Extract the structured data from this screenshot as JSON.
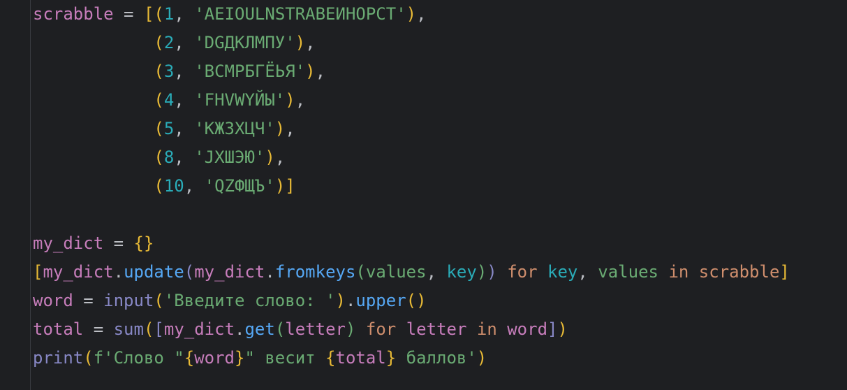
{
  "colors": {
    "background": "#1e1f22",
    "gutter_border": "#393b40",
    "variable": "#c77dbb",
    "default": "#bcbec4",
    "number": "#2aacb8",
    "string": "#6aab73",
    "paren_outer": "#e8ba36",
    "paren_inner": "#6aab73",
    "bracket_outer": "#e8ba36",
    "keyword": "#cf8e6d",
    "builtin": "#8888c6",
    "method": "#56a8f5",
    "loop_var": "#2aacb8",
    "brace": "#e8ba36"
  },
  "code": {
    "lines": [
      {
        "tokens": [
          {
            "t": "scrabble",
            "c": "variable"
          },
          {
            "t": " = ",
            "c": "default"
          },
          {
            "t": "[",
            "c": "bracket_outer"
          },
          {
            "t": "(",
            "c": "paren_outer"
          },
          {
            "t": "1",
            "c": "number"
          },
          {
            "t": ", ",
            "c": "default"
          },
          {
            "t": "'AEIOULNSTRABEИНОРСТ'",
            "c": "string"
          },
          {
            "t": ")",
            "c": "paren_outer"
          },
          {
            "t": ",",
            "c": "default"
          }
        ]
      },
      {
        "tokens": [
          {
            "t": "            ",
            "c": "default"
          },
          {
            "t": "(",
            "c": "paren_outer"
          },
          {
            "t": "2",
            "c": "number"
          },
          {
            "t": ", ",
            "c": "default"
          },
          {
            "t": "'DGДКЛМПУ'",
            "c": "string"
          },
          {
            "t": ")",
            "c": "paren_outer"
          },
          {
            "t": ",",
            "c": "default"
          }
        ]
      },
      {
        "tokens": [
          {
            "t": "            ",
            "c": "default"
          },
          {
            "t": "(",
            "c": "paren_outer"
          },
          {
            "t": "3",
            "c": "number"
          },
          {
            "t": ", ",
            "c": "default"
          },
          {
            "t": "'BCMPБГЁЬЯ'",
            "c": "string"
          },
          {
            "t": ")",
            "c": "paren_outer"
          },
          {
            "t": ",",
            "c": "default"
          }
        ]
      },
      {
        "tokens": [
          {
            "t": "            ",
            "c": "default"
          },
          {
            "t": "(",
            "c": "paren_outer"
          },
          {
            "t": "4",
            "c": "number"
          },
          {
            "t": ", ",
            "c": "default"
          },
          {
            "t": "'FHVWYЙЫ'",
            "c": "string"
          },
          {
            "t": ")",
            "c": "paren_outer"
          },
          {
            "t": ",",
            "c": "default"
          }
        ]
      },
      {
        "tokens": [
          {
            "t": "            ",
            "c": "default"
          },
          {
            "t": "(",
            "c": "paren_outer"
          },
          {
            "t": "5",
            "c": "number"
          },
          {
            "t": ", ",
            "c": "default"
          },
          {
            "t": "'КЖЗХЦЧ'",
            "c": "string"
          },
          {
            "t": ")",
            "c": "paren_outer"
          },
          {
            "t": ",",
            "c": "default"
          }
        ]
      },
      {
        "tokens": [
          {
            "t": "            ",
            "c": "default"
          },
          {
            "t": "(",
            "c": "paren_outer"
          },
          {
            "t": "8",
            "c": "number"
          },
          {
            "t": ", ",
            "c": "default"
          },
          {
            "t": "'JXШЭЮ'",
            "c": "string"
          },
          {
            "t": ")",
            "c": "paren_outer"
          },
          {
            "t": ",",
            "c": "default"
          }
        ]
      },
      {
        "tokens": [
          {
            "t": "            ",
            "c": "default"
          },
          {
            "t": "(",
            "c": "paren_outer"
          },
          {
            "t": "10",
            "c": "number"
          },
          {
            "t": ", ",
            "c": "default"
          },
          {
            "t": "'QZФЩЪ'",
            "c": "string"
          },
          {
            "t": ")",
            "c": "paren_outer"
          },
          {
            "t": "]",
            "c": "bracket_outer"
          }
        ]
      },
      {
        "tokens": []
      },
      {
        "tokens": []
      },
      {
        "tokens": [
          {
            "t": "my_dict",
            "c": "variable"
          },
          {
            "t": " = ",
            "c": "default"
          },
          {
            "t": "{}",
            "c": "brace"
          }
        ]
      },
      {
        "tokens": [
          {
            "t": "[",
            "c": "bracket_outer"
          },
          {
            "t": "my_dict",
            "c": "variable"
          },
          {
            "t": ".",
            "c": "default"
          },
          {
            "t": "update",
            "c": "method"
          },
          {
            "t": "(",
            "c": "builtin"
          },
          {
            "t": "my_dict",
            "c": "variable"
          },
          {
            "t": ".",
            "c": "default"
          },
          {
            "t": "fromkeys",
            "c": "method"
          },
          {
            "t": "(",
            "c": "paren_inner"
          },
          {
            "t": "values",
            "c": "paren_inner"
          },
          {
            "t": ", ",
            "c": "default"
          },
          {
            "t": "key",
            "c": "loop_var"
          },
          {
            "t": ")",
            "c": "paren_inner"
          },
          {
            "t": ")",
            "c": "builtin"
          },
          {
            "t": " ",
            "c": "default"
          },
          {
            "t": "for",
            "c": "keyword"
          },
          {
            "t": " ",
            "c": "default"
          },
          {
            "t": "key",
            "c": "loop_var"
          },
          {
            "t": ", ",
            "c": "default"
          },
          {
            "t": "values",
            "c": "paren_inner"
          },
          {
            "t": " ",
            "c": "default"
          },
          {
            "t": "in",
            "c": "keyword"
          },
          {
            "t": " ",
            "c": "default"
          },
          {
            "t": "scrabble",
            "c": "keyword"
          },
          {
            "t": "]",
            "c": "bracket_outer"
          }
        ]
      },
      {
        "tokens": [
          {
            "t": "word",
            "c": "variable"
          },
          {
            "t": " = ",
            "c": "default"
          },
          {
            "t": "input",
            "c": "builtin"
          },
          {
            "t": "(",
            "c": "paren_outer"
          },
          {
            "t": "'Введите слово: '",
            "c": "string"
          },
          {
            "t": ")",
            "c": "paren_outer"
          },
          {
            "t": ".",
            "c": "default"
          },
          {
            "t": "upper",
            "c": "method"
          },
          {
            "t": "()",
            "c": "paren_outer"
          }
        ]
      },
      {
        "tokens": [
          {
            "t": "total",
            "c": "variable"
          },
          {
            "t": " = ",
            "c": "default"
          },
          {
            "t": "sum",
            "c": "builtin"
          },
          {
            "t": "(",
            "c": "paren_outer"
          },
          {
            "t": "[",
            "c": "builtin"
          },
          {
            "t": "my_dict",
            "c": "variable"
          },
          {
            "t": ".",
            "c": "default"
          },
          {
            "t": "get",
            "c": "method"
          },
          {
            "t": "(",
            "c": "paren_inner"
          },
          {
            "t": "letter",
            "c": "variable"
          },
          {
            "t": ")",
            "c": "paren_inner"
          },
          {
            "t": " ",
            "c": "default"
          },
          {
            "t": "for",
            "c": "keyword"
          },
          {
            "t": " ",
            "c": "default"
          },
          {
            "t": "letter",
            "c": "variable"
          },
          {
            "t": " ",
            "c": "default"
          },
          {
            "t": "in",
            "c": "keyword"
          },
          {
            "t": " ",
            "c": "default"
          },
          {
            "t": "word",
            "c": "variable"
          },
          {
            "t": "]",
            "c": "builtin"
          },
          {
            "t": ")",
            "c": "paren_outer"
          }
        ]
      },
      {
        "tokens": [
          {
            "t": "print",
            "c": "builtin"
          },
          {
            "t": "(",
            "c": "paren_outer"
          },
          {
            "t": "f'Слово \"",
            "c": "string"
          },
          {
            "t": "{",
            "c": "brace"
          },
          {
            "t": "word",
            "c": "variable"
          },
          {
            "t": "}",
            "c": "brace"
          },
          {
            "t": "\" весит ",
            "c": "string"
          },
          {
            "t": "{",
            "c": "brace"
          },
          {
            "t": "total",
            "c": "variable"
          },
          {
            "t": "}",
            "c": "brace"
          },
          {
            "t": " баллов'",
            "c": "string"
          },
          {
            "t": ")",
            "c": "paren_outer"
          }
        ]
      }
    ]
  }
}
